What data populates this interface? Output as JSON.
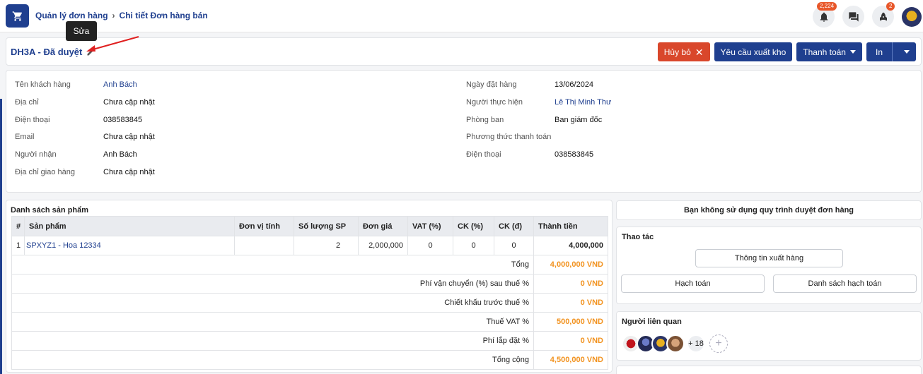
{
  "breadcrumb": {
    "parent": "Quản lý đơn hàng",
    "current": "Chi tiết Đơn hàng bán"
  },
  "topbar": {
    "notifications_count": "2,224",
    "rocket_count": "2"
  },
  "tooltip": {
    "text": "Sửa"
  },
  "order": {
    "title": "DH3A - Đã duyệt"
  },
  "actions": {
    "cancel": "Hủy bỏ",
    "export_request": "Yêu cầu xuất kho",
    "payment": "Thanh toán",
    "print": "In"
  },
  "customer": {
    "name_label": "Tên khách hàng",
    "name": "Anh Bách",
    "address_label": "Địa chỉ",
    "address": "Chưa cập nhật",
    "phone_label": "Điện thoại",
    "phone": "038583845",
    "email_label": "Email",
    "email": "Chưa cập nhật",
    "receiver_label": "Người nhận",
    "receiver": "Anh Bách",
    "shipping_label": "Địa chỉ giao hàng",
    "shipping": "Chưa cập nhật"
  },
  "order_info": {
    "date_label": "Ngày đặt hàng",
    "date": "13/06/2024",
    "handler_label": "Người thực hiện",
    "handler": "Lê Thị Minh Thư",
    "dept_label": "Phòng ban",
    "dept": "Ban giám đốc",
    "payment_label": "Phương thức thanh toán",
    "payment": "",
    "phone_label": "Điện thoại",
    "phone": "038583845"
  },
  "products": {
    "title": "Danh sách sản phẩm",
    "headers": [
      "#",
      "Sản phẩm",
      "Đơn vị tính",
      "Số lượng SP",
      "Đơn giá",
      "VAT (%)",
      "CK (%)",
      "CK (đ)",
      "Thành tiền"
    ],
    "row": {
      "idx": "1",
      "name": "SPXYZ1 - Hoa 12334",
      "unit": "",
      "qty": "2",
      "price": "2,000,000",
      "vat": "0",
      "ck_pct": "0",
      "ck_amt": "0",
      "total": "4,000,000"
    },
    "summary": [
      {
        "label": "Tổng",
        "value": "4,000,000 VND"
      },
      {
        "label": "Phí vận chuyển (%) sau thuế %",
        "value": "0 VND"
      },
      {
        "label": "Chiết khấu trước thuế %",
        "value": "0 VND"
      },
      {
        "label": "Thuế VAT %",
        "value": "500,000 VND"
      },
      {
        "label": "Phí lắp đặt %",
        "value": "0 VND"
      },
      {
        "label": "Tổng cộng",
        "value": "4,500,000 VND"
      }
    ]
  },
  "approval_notice": "Bạn không sử dụng quy trình duyệt đơn hàng",
  "operations": {
    "title": "Thao tác",
    "export_info": "Thông tin xuất hàng",
    "accounting": "Hạch toán",
    "accounting_list": "Danh sách hạch toán"
  },
  "related": {
    "title": "Người liên quan",
    "more": "+ 18",
    "add": "+"
  },
  "colors": {
    "primary": "#1f3f8f",
    "danger": "#d9472b",
    "amount": "#f29320"
  }
}
